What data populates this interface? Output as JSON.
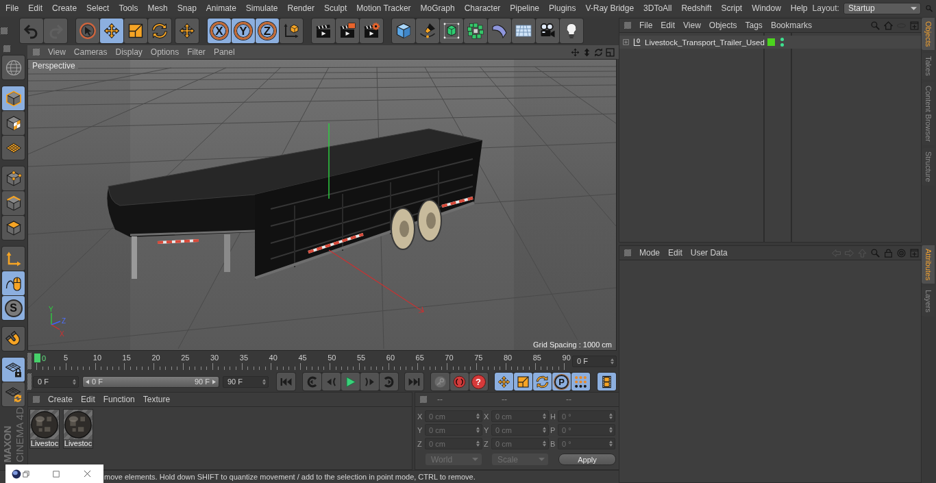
{
  "menu_bar": {
    "items": [
      "File",
      "Edit",
      "Create",
      "Select",
      "Tools",
      "Mesh",
      "Snap",
      "Animate",
      "Simulate",
      "Render",
      "Sculpt",
      "Motion Tracker",
      "MoGraph",
      "Character",
      "Pipeline",
      "Plugins",
      "V-Ray Bridge",
      "3DToAll",
      "Redshift",
      "Script",
      "Window",
      "Help"
    ],
    "layout_label": "Layout:",
    "layout_value": "Startup"
  },
  "toolbar": {
    "groups": [
      {
        "items": [
          {
            "kind": "undo",
            "selected": false,
            "disabled": false
          },
          {
            "kind": "redo",
            "selected": false,
            "disabled": true
          }
        ]
      },
      {
        "items": [
          {
            "kind": "live-select",
            "selected": false,
            "disabled": false
          },
          {
            "kind": "move",
            "selected": true,
            "disabled": false
          },
          {
            "kind": "scale",
            "selected": false,
            "disabled": false
          },
          {
            "kind": "rotate",
            "selected": false,
            "disabled": false
          }
        ]
      },
      {
        "items": [
          {
            "kind": "move",
            "selected": false,
            "disabled": false
          }
        ]
      },
      {
        "items": [
          {
            "kind": "axis-lock",
            "label": "X",
            "selected": true,
            "disabled": false
          },
          {
            "kind": "axis-lock",
            "label": "Y",
            "selected": true,
            "disabled": false
          },
          {
            "kind": "axis-lock",
            "label": "Z",
            "selected": true,
            "disabled": false
          },
          {
            "kind": "coordinate-system",
            "selected": false,
            "disabled": false
          }
        ]
      },
      {
        "items": [
          {
            "kind": "render-view",
            "selected": false,
            "disabled": false
          },
          {
            "kind": "render-picture-viewer",
            "selected": false,
            "disabled": false
          },
          {
            "kind": "render-settings",
            "selected": false,
            "disabled": false
          }
        ]
      },
      {
        "items": [
          {
            "kind": "cube",
            "selected": false,
            "disabled": false
          },
          {
            "kind": "pen",
            "selected": false,
            "disabled": false
          },
          {
            "kind": "subdivision",
            "selected": false,
            "disabled": false
          },
          {
            "kind": "cloner",
            "selected": false,
            "disabled": false
          },
          {
            "kind": "deformer",
            "selected": false,
            "disabled": false
          },
          {
            "kind": "floor",
            "selected": false,
            "disabled": false
          },
          {
            "kind": "camera",
            "selected": false,
            "disabled": false
          },
          {
            "kind": "light",
            "selected": false,
            "disabled": false
          }
        ]
      }
    ]
  },
  "left_toolbar": {
    "groups": [
      {
        "items": [
          {
            "kind": "globe",
            "selected": false
          }
        ]
      },
      {
        "items": [
          {
            "kind": "model-mode",
            "selected": true
          },
          {
            "kind": "texture-mode",
            "selected": false
          },
          {
            "kind": "workplane-mode",
            "selected": false
          }
        ]
      },
      {
        "items": [
          {
            "kind": "points-mode",
            "selected": false
          },
          {
            "kind": "edges-mode",
            "selected": false
          },
          {
            "kind": "polygons-mode",
            "selected": false
          }
        ]
      },
      {
        "items": [
          {
            "kind": "axis-mode",
            "selected": false
          },
          {
            "kind": "tweak-mode",
            "selected": true
          },
          {
            "kind": "snap",
            "label": "S",
            "selected": true
          }
        ]
      },
      {
        "items": [
          {
            "kind": "magnet",
            "selected": false
          }
        ]
      },
      {
        "items": [
          {
            "kind": "grid-lock",
            "selected": true
          },
          {
            "kind": "grid-rotate",
            "selected": false
          }
        ]
      }
    ]
  },
  "brand": {
    "maker": "MAXON",
    "product": "CINEMA 4D"
  },
  "viewport": {
    "menu": [
      "View",
      "Cameras",
      "Display",
      "Options",
      "Filter",
      "Panel"
    ],
    "camera": "Perspective",
    "grid_spacing": "Grid Spacing : 1000 cm",
    "axis_gizmo": {
      "x": "X",
      "y": "Y",
      "z": "Z"
    }
  },
  "timeline": {
    "playhead": {
      "level": 0,
      "label": "0"
    },
    "ticks": [
      "5",
      "10",
      "15",
      "20",
      "25",
      "30",
      "35",
      "40",
      "45",
      "50",
      "55",
      "60",
      "65",
      "70",
      "75",
      "80",
      "85",
      "90"
    ],
    "current_frame": "0 F"
  },
  "transport": {
    "start_field": "0 F",
    "range": {
      "start": "0 F",
      "end": "90 F",
      "level": 1
    },
    "end_field": "90 F",
    "groups": [
      {
        "items": [
          {
            "kind": "first-frame",
            "selected": false,
            "disabled": false
          }
        ]
      },
      {
        "items": [
          {
            "kind": "prev-key",
            "selected": false,
            "disabled": false
          },
          {
            "kind": "prev-frame",
            "selected": false,
            "disabled": false
          },
          {
            "kind": "play",
            "selected": false,
            "disabled": false
          },
          {
            "kind": "next-frame",
            "selected": false,
            "disabled": false
          },
          {
            "kind": "next-key",
            "selected": false,
            "disabled": false
          }
        ]
      },
      {
        "items": [
          {
            "kind": "last-frame",
            "selected": false,
            "disabled": false
          }
        ]
      },
      {
        "items": [
          {
            "kind": "record-keyframe",
            "selected": false,
            "disabled": true
          },
          {
            "kind": "autokey",
            "selected": false,
            "disabled": false
          },
          {
            "kind": "help",
            "label": "?",
            "selected": false,
            "disabled": false
          }
        ]
      },
      {
        "items": [
          {
            "kind": "move",
            "selected": true,
            "disabled": false
          },
          {
            "kind": "scale",
            "selected": true,
            "disabled": false
          },
          {
            "kind": "rotate",
            "selected": true,
            "disabled": false
          },
          {
            "kind": "point-mode",
            "label": "P",
            "selected": true,
            "disabled": false
          },
          {
            "kind": "dot-grid",
            "selected": true,
            "disabled": false
          }
        ]
      },
      {
        "items": [
          {
            "kind": "film-strip",
            "selected": true,
            "disabled": false
          }
        ]
      }
    ]
  },
  "materials": {
    "menu": [
      "Create",
      "Edit",
      "Function",
      "Texture"
    ],
    "items": [
      {
        "label": "Livestoc"
      },
      {
        "label": "Livestoc"
      }
    ]
  },
  "coordinates": {
    "headers": [
      "--",
      "--",
      "--"
    ],
    "rows": [
      {
        "cells": [
          {
            "axis": "X",
            "value": "0 cm"
          },
          {
            "axis": "X",
            "value": "0 cm"
          },
          {
            "axis": "H",
            "value": "0 °"
          }
        ]
      },
      {
        "cells": [
          {
            "axis": "Y",
            "value": "0 cm"
          },
          {
            "axis": "Y",
            "value": "0 cm"
          },
          {
            "axis": "P",
            "value": "0 °"
          }
        ]
      },
      {
        "cells": [
          {
            "axis": "Z",
            "value": "0 cm"
          },
          {
            "axis": "Z",
            "value": "0 cm"
          },
          {
            "axis": "B",
            "value": "0 °"
          }
        ]
      }
    ],
    "mode": "World",
    "transform": "Scale",
    "apply": "Apply"
  },
  "status_bar": {
    "text": "move elements. Hold down SHIFT to quantize movement / add to the selection in point mode, CTRL to remove."
  },
  "objects_panel": {
    "menu": [
      "File",
      "Edit",
      "View",
      "Objects",
      "Tags",
      "Bookmarks"
    ],
    "tree": [
      {
        "name": "Livestock_Transport_Trailer_Used",
        "expanded": false,
        "color": "#4cd41e",
        "editor_visible": true,
        "render_visible": true
      }
    ]
  },
  "attributes_panel": {
    "menu": [
      "Mode",
      "Edit",
      "User Data"
    ]
  },
  "side_tabs": {
    "upper": [
      {
        "label": "Objects",
        "selected": true
      },
      {
        "label": "Takes",
        "selected": false
      },
      {
        "label": "Content Browser",
        "selected": false
      },
      {
        "label": "Structure",
        "selected": false
      }
    ],
    "lower": [
      {
        "label": "Attributes",
        "selected": true
      },
      {
        "label": "Layers",
        "selected": false
      }
    ]
  }
}
